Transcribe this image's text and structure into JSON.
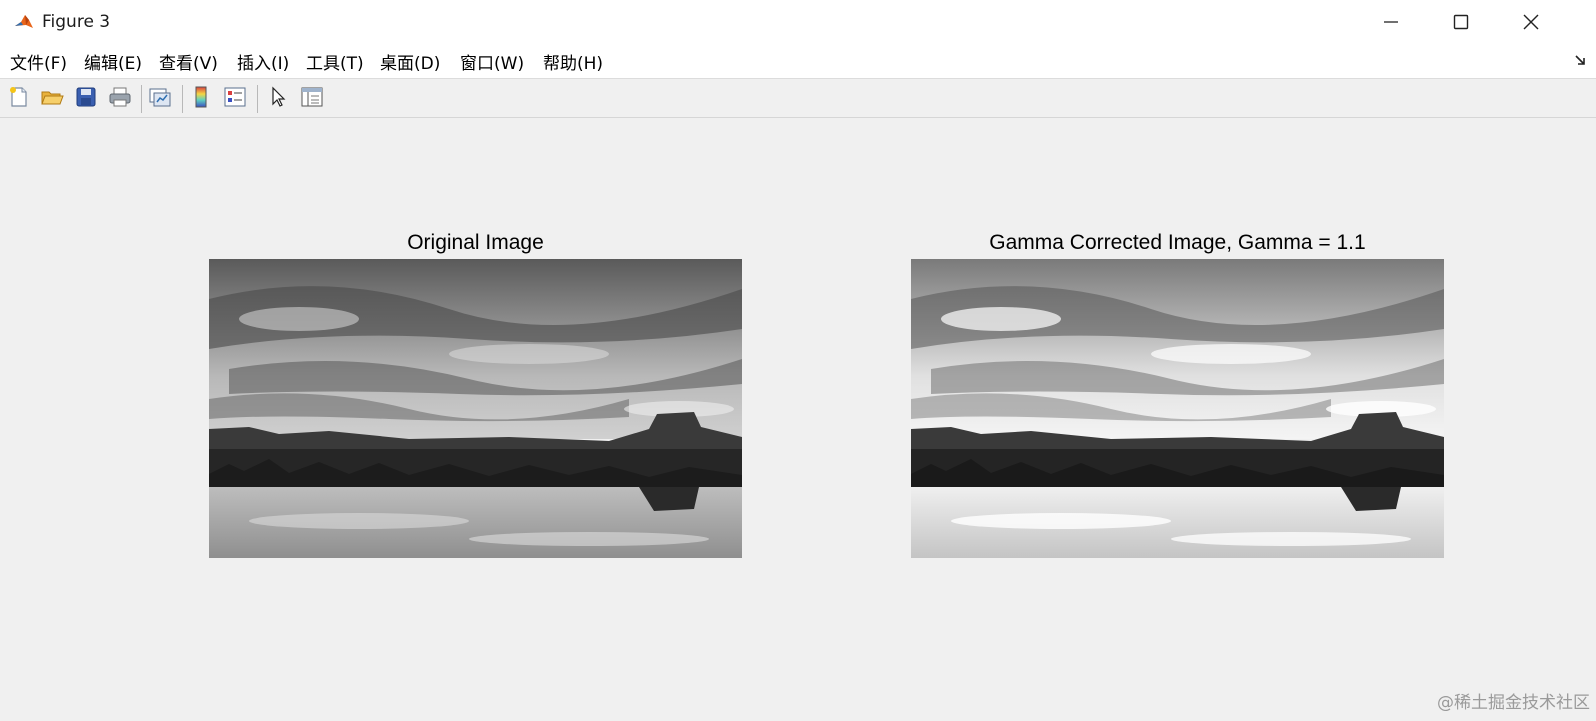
{
  "window": {
    "title": "Figure 3"
  },
  "menu": [
    {
      "label": "文件(F)"
    },
    {
      "label": "编辑(E)"
    },
    {
      "label": "查看(V)"
    },
    {
      "label": "插入(I)"
    },
    {
      "label": "工具(T)"
    },
    {
      "label": "桌面(D)"
    },
    {
      "label": "窗口(W)"
    },
    {
      "label": "帮助(H)"
    }
  ],
  "toolbar": [
    {
      "icon": "new-file-icon"
    },
    {
      "icon": "open-folder-icon"
    },
    {
      "icon": "save-icon"
    },
    {
      "icon": "print-icon"
    },
    {
      "icon": "link-plot-icon"
    },
    {
      "icon": "colorbar-icon"
    },
    {
      "icon": "legend-icon"
    },
    {
      "icon": "pointer-icon"
    },
    {
      "icon": "property-inspector-icon"
    }
  ],
  "axes": [
    {
      "title": "Original Image",
      "image": "grayscale-lake-landscape"
    },
    {
      "title": "Gamma Corrected Image, Gamma = 1.1",
      "image": "brightened-grayscale-lake-landscape"
    }
  ],
  "watermark": "@稀土掘金技术社区",
  "colors": {
    "titlebar": "#ffffff",
    "background": "#f0f0f0",
    "matlab_orange": "#e8651b"
  }
}
